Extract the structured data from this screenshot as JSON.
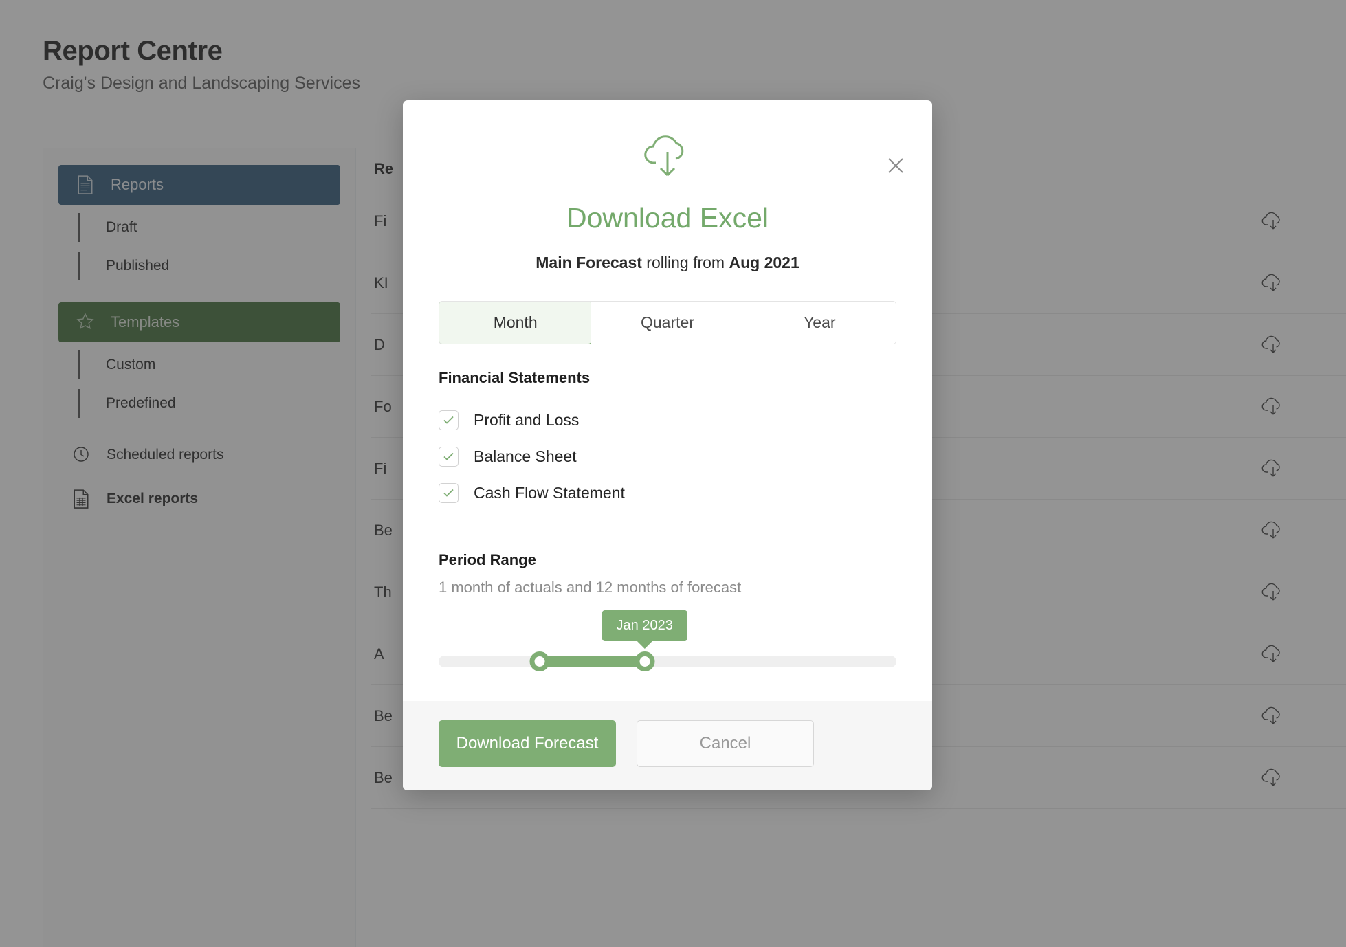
{
  "header": {
    "title": "Report Centre",
    "subtitle": "Craig's Design and Landscaping Services"
  },
  "sidebar": {
    "items": [
      {
        "label": "Reports",
        "icon": "document-icon",
        "style": "pill-blue"
      },
      {
        "label": "Draft",
        "style": "sub"
      },
      {
        "label": "Published",
        "style": "sub"
      },
      {
        "label": "Templates",
        "icon": "star-icon",
        "style": "pill-green"
      },
      {
        "label": "Custom",
        "style": "sub"
      },
      {
        "label": "Predefined",
        "style": "sub"
      },
      {
        "label": "Scheduled reports",
        "icon": "clock-icon",
        "style": "plain"
      },
      {
        "label": "Excel reports",
        "icon": "spreadsheet-icon",
        "style": "plain-active"
      }
    ]
  },
  "table": {
    "header": "Re",
    "rows": [
      {
        "name": "Fi",
        "action_icon": "cloud-download-icon"
      },
      {
        "name": "KI",
        "action_icon": "cloud-download-icon"
      },
      {
        "name": "D",
        "action_icon": "cloud-download-icon"
      },
      {
        "name": "Fo",
        "action_icon": "cloud-download-icon"
      },
      {
        "name": "Fi",
        "action_icon": "cloud-download-icon"
      },
      {
        "name": "Be",
        "action_icon": "cloud-download-icon"
      },
      {
        "name": "Th",
        "action_icon": "cloud-download-icon"
      },
      {
        "name": "A",
        "action_icon": "cloud-download-icon"
      },
      {
        "name": "Be",
        "action_icon": "cloud-download-icon"
      },
      {
        "name": "Be",
        "action_icon": "cloud-download-icon"
      }
    ]
  },
  "modal": {
    "close_icon": "close-icon",
    "hero_icon": "cloud-download-icon",
    "title": "Download Excel",
    "subtitle_strong_1": "Main Forecast",
    "subtitle_mid": " rolling from ",
    "subtitle_strong_2": "Aug 2021",
    "granularity": {
      "options": [
        "Month",
        "Quarter",
        "Year"
      ],
      "selected": "Month"
    },
    "statements": {
      "section_title": "Financial Statements",
      "items": [
        {
          "label": "Profit and Loss",
          "checked": true
        },
        {
          "label": "Balance Sheet",
          "checked": true
        },
        {
          "label": "Cash Flow Statement",
          "checked": true
        }
      ]
    },
    "period": {
      "title": "Period Range",
      "description": "1 month of actuals and 12 months of forecast",
      "tooltip_value": "Jan 2023"
    },
    "footer": {
      "primary_label": "Download Forecast",
      "secondary_label": "Cancel"
    }
  },
  "colors": {
    "accent_green": "#7fae74",
    "nav_blue": "#2a5676",
    "nav_green": "#3f6b37"
  }
}
